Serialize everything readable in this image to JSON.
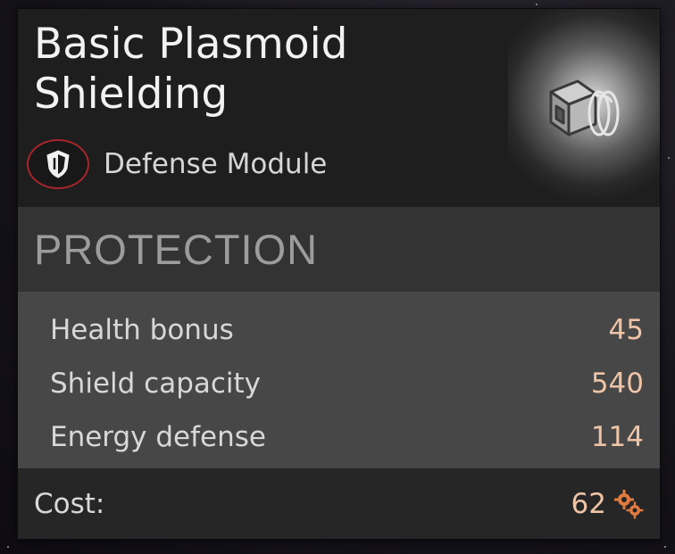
{
  "item": {
    "title_line1": "Basic Plasmoid",
    "title_line2": "Shielding",
    "type_label": "Defense Module",
    "type_icon": "shield-icon",
    "item_icon": "shield-module-cube-icon"
  },
  "section": {
    "title": "PROTECTION"
  },
  "stats": [
    {
      "label": "Health bonus",
      "value": "45"
    },
    {
      "label": "Shield capacity",
      "value": "540"
    },
    {
      "label": "Energy defense",
      "value": "114"
    }
  ],
  "cost": {
    "label": "Cost:",
    "value": "62",
    "icon": "gears-icon"
  },
  "colors": {
    "badge_ring": "#a4262c",
    "value_text": "#efc4a6",
    "cost_icon": "#e07a3f"
  }
}
